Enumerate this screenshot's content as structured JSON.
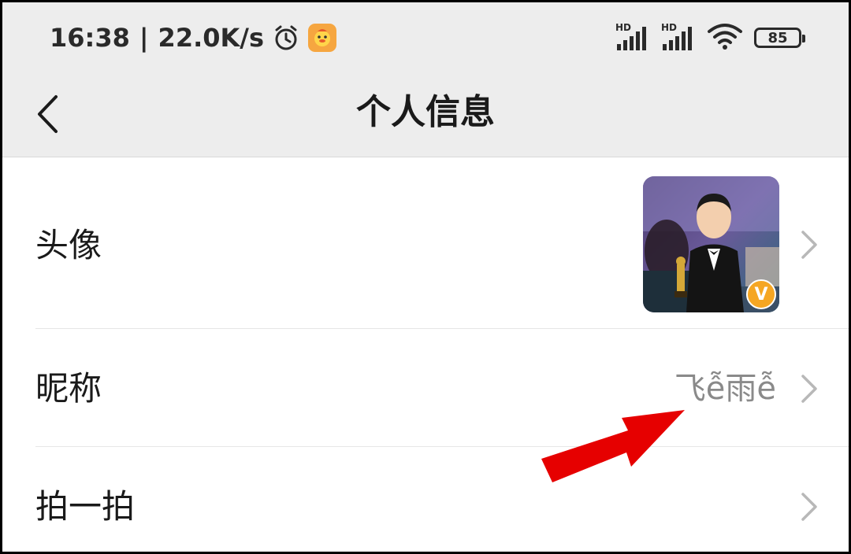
{
  "status_bar": {
    "time": "16:38",
    "separator": "|",
    "network_speed": "22.0K/s",
    "icons": [
      "alarm-icon",
      "app-notification-icon",
      "hd-signal-icon",
      "hd-signal-icon",
      "wifi-icon",
      "battery-icon"
    ],
    "signal_1_label": "HD",
    "signal_2_label": "HD",
    "battery_level": "85"
  },
  "nav": {
    "back_icon": "chevron-left-icon",
    "title": "个人信息"
  },
  "rows": [
    {
      "label": "头像",
      "value": "",
      "type": "avatar"
    },
    {
      "label": "昵称",
      "value": "飞ễ雨ễ",
      "type": "text"
    },
    {
      "label": "拍一拍",
      "value": "",
      "type": "text"
    }
  ],
  "avatar": {
    "badge": "V"
  },
  "colors": {
    "header_bg": "#ededed",
    "content_bg": "#ffffff",
    "badge": "#f5a623",
    "annotation_arrow": "#e60000"
  }
}
